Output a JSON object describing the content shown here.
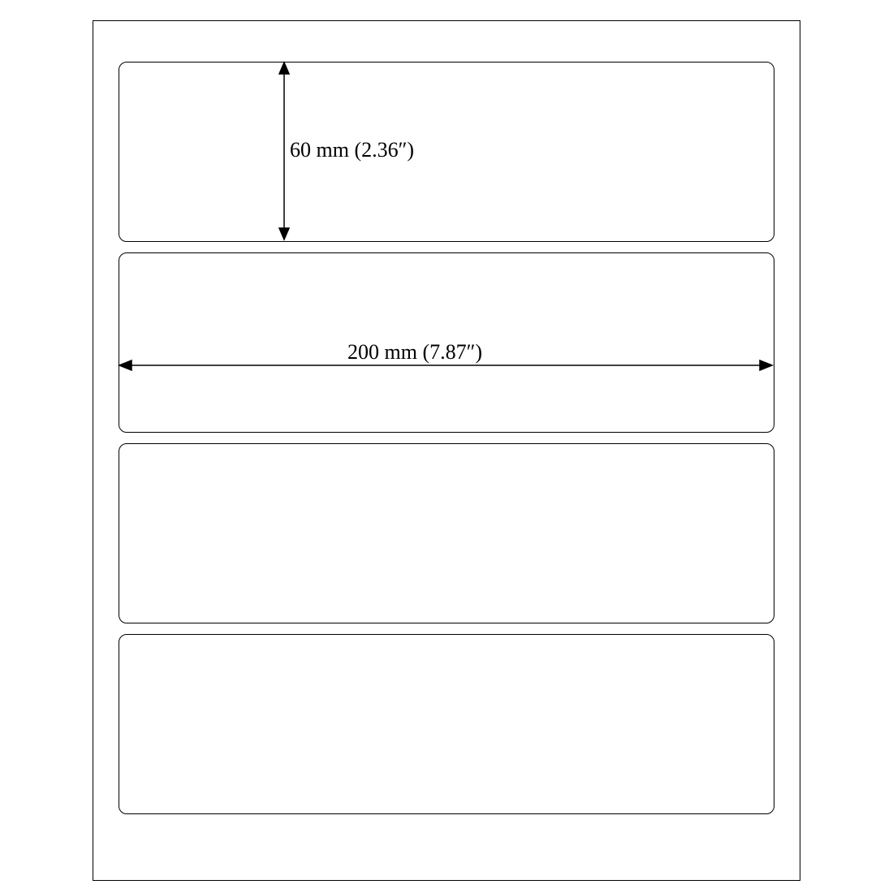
{
  "diagram": {
    "label_count": 4,
    "height_label": "60 mm (2.36″)",
    "width_label": "200 mm (7.87″)",
    "height_mm": 60,
    "width_mm": 200,
    "height_in": 2.36,
    "width_in": 7.87
  }
}
